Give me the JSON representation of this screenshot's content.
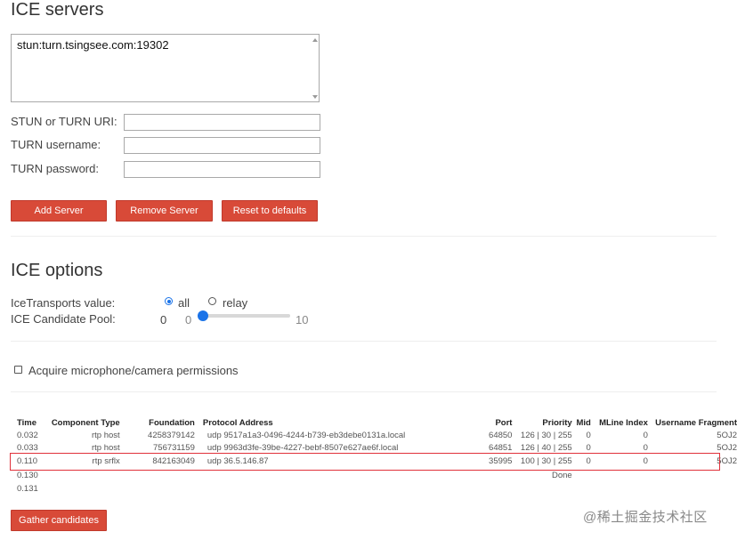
{
  "ice_servers": {
    "title": "ICE servers",
    "server_list_value": "stun:turn.tsingsee.com:19302",
    "stun_turn_uri_label": "STUN or TURN URI:",
    "turn_username_label": "TURN username:",
    "turn_password_label": "TURN password:",
    "add_server": "Add Server",
    "remove_server": "Remove Server",
    "reset_defaults": "Reset to defaults"
  },
  "ice_options": {
    "title": "ICE options",
    "ice_transports_label": "IceTransports value:",
    "option_all": "all",
    "option_relay": "relay",
    "selected_transport": "all",
    "candidate_pool_label": "ICE Candidate Pool:",
    "candidate_pool_value": "0",
    "slider_min": "0",
    "slider_max": "10",
    "slider_value": 0
  },
  "permissions": {
    "acquire_label": "Acquire microphone/camera permissions",
    "checked": false
  },
  "candidates": {
    "headers": {
      "time": "Time",
      "component": "Component Type",
      "foundation": "Foundation",
      "protocol": "Protocol",
      "address": "Address",
      "port": "Port",
      "priority": "Priority",
      "mid": "Mid",
      "mline": "MLine Index",
      "ufrag": "Username Fragment"
    },
    "rows": [
      {
        "time": "0.032",
        "component": "rtp",
        "type": "host",
        "foundation": "4258379142",
        "protocol": "udp",
        "address": "9517a1a3-0496-4244-b739-eb3debe0131a.local",
        "port": "64850",
        "priority": "126 | 30 | 255",
        "mid": "0",
        "mline": "0",
        "ufrag": "5OJ2"
      },
      {
        "time": "0.033",
        "component": "rtp",
        "type": "host",
        "foundation": "756731159",
        "protocol": "udp",
        "address": "9963d3fe-39be-4227-bebf-8507e627ae6f.local",
        "port": "64851",
        "priority": "126 | 40 | 255",
        "mid": "0",
        "mline": "0",
        "ufrag": "5OJ2"
      },
      {
        "time": "0.110",
        "component": "rtp",
        "type": "srflx",
        "foundation": "842163049",
        "protocol": "udp",
        "address": "36.5.146.87",
        "port": "35995",
        "priority": "100 | 30 | 255",
        "mid": "0",
        "mline": "0",
        "ufrag": "5OJ2"
      },
      {
        "time": "0.130",
        "component": "",
        "type": "",
        "foundation": "",
        "protocol": "",
        "address": "",
        "port": "",
        "priority": "Done",
        "mid": "",
        "mline": "",
        "ufrag": ""
      },
      {
        "time": "0.131",
        "component": "",
        "type": "",
        "foundation": "",
        "protocol": "",
        "address": "",
        "port": "",
        "priority": "",
        "mid": "",
        "mline": "",
        "ufrag": ""
      }
    ]
  },
  "gather_button": "Gather candidates",
  "watermark": "@稀土掘金技术社区",
  "colors": {
    "button": "#d84a38",
    "accent": "#1a73e8",
    "highlight": "#e0303a"
  }
}
